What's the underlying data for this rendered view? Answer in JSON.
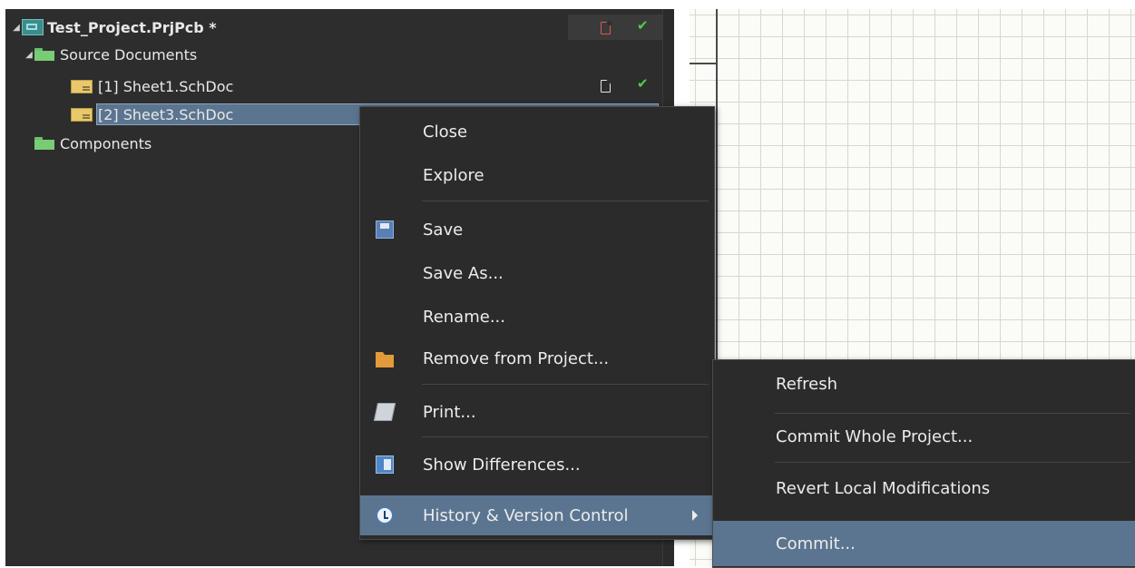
{
  "project_tree": {
    "project": {
      "name": "Test_Project.PrjPcb *"
    },
    "source_folder": {
      "name": "Source Documents"
    },
    "documents": [
      {
        "name": "[1] Sheet1.SchDoc"
      },
      {
        "name": "[2] Sheet3.SchDoc"
      }
    ],
    "components_folder": {
      "name": "Components"
    }
  },
  "context_menu": {
    "items": [
      {
        "label": "Close"
      },
      {
        "label": "Explore"
      },
      {
        "label": "Save"
      },
      {
        "label": "Save As..."
      },
      {
        "label": "Rename..."
      },
      {
        "label": "Remove from Project..."
      },
      {
        "label": "Print..."
      },
      {
        "label": "Show Differences..."
      },
      {
        "label": "History & Version Control"
      }
    ]
  },
  "submenu": {
    "items": [
      {
        "label": "Refresh"
      },
      {
        "label": "Commit Whole Project..."
      },
      {
        "label": "Revert Local Modifications"
      },
      {
        "label": "Commit..."
      }
    ]
  },
  "icons": {
    "save": "save-icon",
    "remove": "remove-icon",
    "print": "print-icon",
    "diff": "show-differences-icon",
    "history": "history-icon"
  },
  "colors": {
    "panel_bg": "#2d2d2d",
    "selection": "#5b7590",
    "check": "#4ccf4c",
    "modified": "#e05555"
  }
}
